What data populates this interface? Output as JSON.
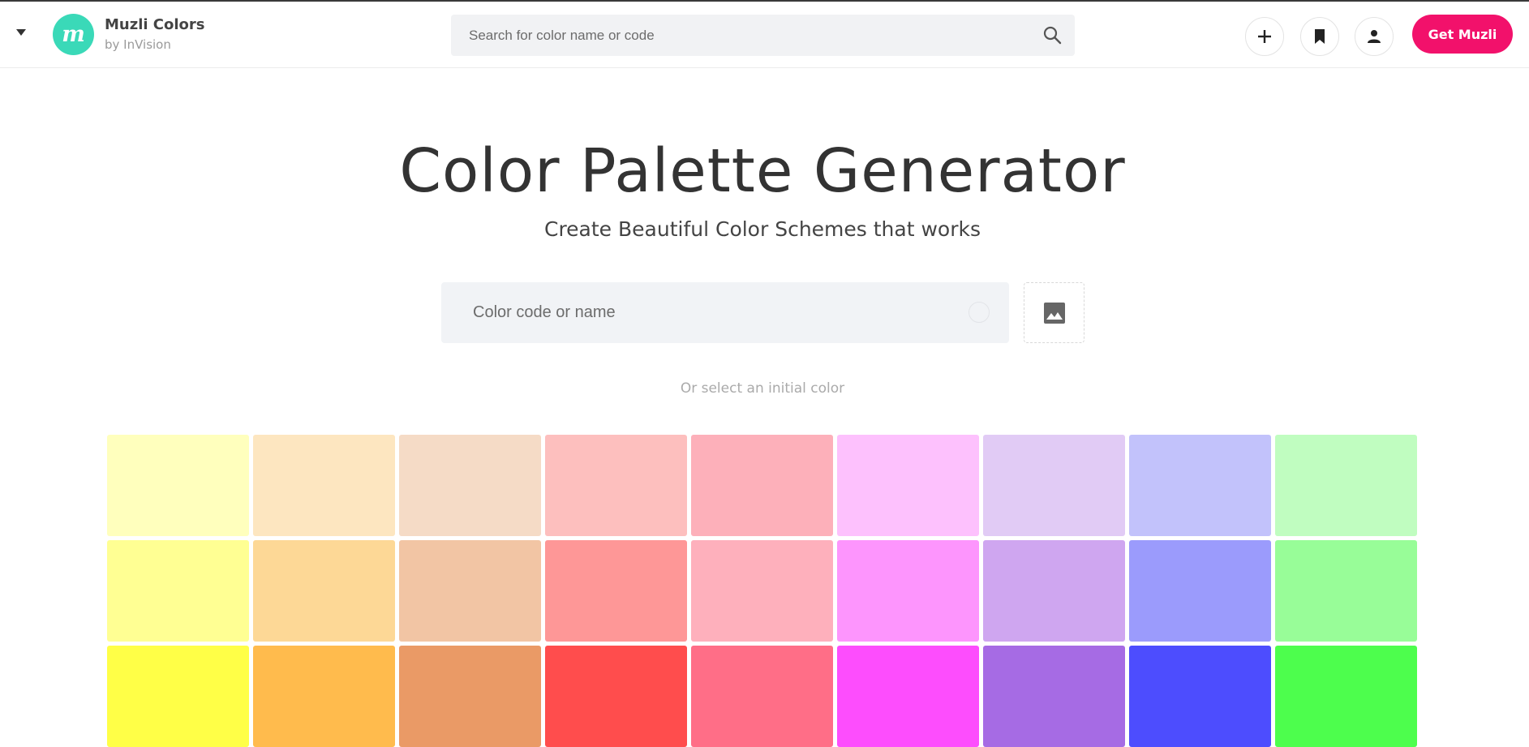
{
  "header": {
    "brand_title": "Muzli Colors",
    "brand_sub": "by InVision",
    "logo_letter": "m",
    "search_placeholder": "Search for color name or code",
    "get_button": "Get Muzli"
  },
  "hero": {
    "title": "Color Palette Generator",
    "subtitle": "Create Beautiful Color Schemes that works",
    "color_input_placeholder": "Color code or name",
    "hint": "Or select an initial color"
  },
  "colors": {
    "accent": "#f2116b",
    "logo": "#3ad9b8",
    "swatches": [
      [
        "#ffffbd",
        "#fde6c0",
        "#f5dbc6",
        "#fdbfbe",
        "#fdb0ba",
        "#fdc1fd",
        "#e1cbf5",
        "#c2c2fb",
        "#c0fdc0"
      ],
      [
        "#ffff93",
        "#fdd896",
        "#f2c5a4",
        "#fe9797",
        "#feb0bc",
        "#fd95fd",
        "#cfa6f0",
        "#9b9bfc",
        "#98fd98"
      ],
      [
        "#ffff47",
        "#ffbb4d",
        "#ea9a66",
        "#ff4d4d",
        "#ff6e87",
        "#fd4dfd",
        "#a66be4",
        "#4d4dfe",
        "#4dfe4d"
      ]
    ]
  }
}
